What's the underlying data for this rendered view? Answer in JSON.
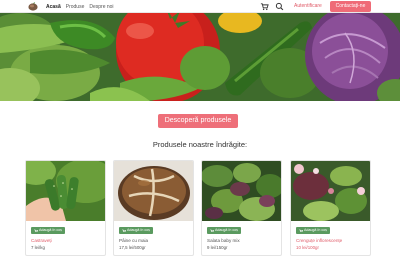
{
  "nav": {
    "links": [
      "Acasă",
      "Produse",
      "Despre noi"
    ],
    "login": "Autentificare",
    "contact": "Contactați-ne"
  },
  "hero": {
    "cta": "Descoperă produsele"
  },
  "section": {
    "title": "Produsele noastre îndrăgite:"
  },
  "products": [
    {
      "name": "Castraveți",
      "price": "7 lei/kg",
      "add": "Adaugă în coș",
      "image": "cucumbers"
    },
    {
      "name": "Pâine cu maia",
      "price": "17,5 lei/500gr",
      "add": "Adaugă în coș",
      "image": "sourdough-bread"
    },
    {
      "name": "Salata baby mix",
      "price": "9 lei/150gr",
      "add": "Adaugă în coș",
      "image": "baby-salad-mix"
    },
    {
      "name": "Crenguțe inflorescențe",
      "price": "10 lei/100gr",
      "add": "Adaugă în coș",
      "image": "microgreens"
    }
  ],
  "colors": {
    "accent": "#ef6b77",
    "add_button": "#5a9a5f",
    "highlight_text": "#e05a67"
  },
  "icons": [
    "logo-icon",
    "cart-icon",
    "search-icon",
    "cart-mini-icon"
  ]
}
